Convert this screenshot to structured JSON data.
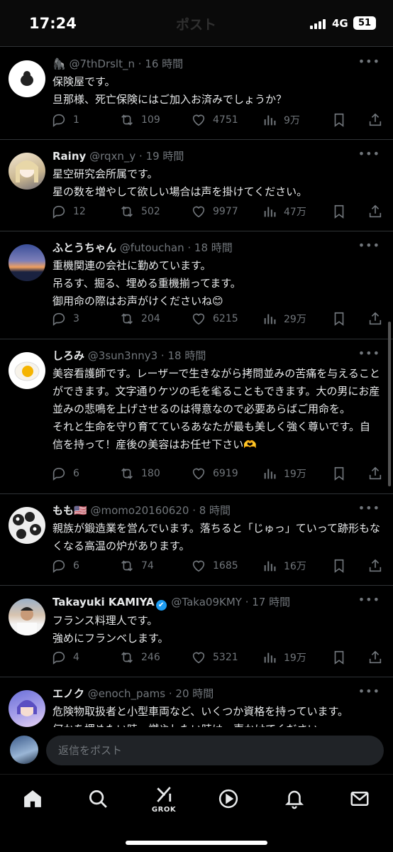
{
  "status": {
    "time": "17:24",
    "network": "4G",
    "battery": "51"
  },
  "header": {
    "title": "ポスト"
  },
  "tweets": [
    {
      "name": "",
      "badge": "🦍",
      "handle": "@7thDrslt_n",
      "time": "16 時間",
      "text": "保険屋です。\n旦那様、死亡保険にはご加入お済みでしょうか？",
      "replies": "1",
      "retweets": "109",
      "likes": "4751",
      "views": "9万"
    },
    {
      "name": "Rainy",
      "badge": "",
      "handle": "@rqxn_y",
      "time": "19 時間",
      "text": "星空研究会所属です。\n星の数を増やして欲しい場合は声を掛けてください。",
      "replies": "12",
      "retweets": "502",
      "likes": "9977",
      "views": "47万"
    },
    {
      "name": "ふとうちゃん",
      "badge": "",
      "handle": "@futouchan",
      "time": "18 時間",
      "text": "重機関連の会社に勤めています。\n吊るす、掘る、埋める重機揃ってます。\n御用命の際はお声がけくださいね😊",
      "replies": "3",
      "retweets": "204",
      "likes": "6215",
      "views": "29万"
    },
    {
      "name": "しろみ",
      "badge": "",
      "handle": "@3sun3nny3",
      "time": "18 時間",
      "text": "美容看護師です。レーザーで生きながら拷問並みの苦痛を与えることができます。文字通りケツの毛を毟ることもできます。大の男にお産並みの悲鳴を上げさせるのは得意なので必要あらばご用命を。\nそれと生命を守り育てているあなたが最も美しく強く尊いです。自信を持って！産後の美容はお任せ下さい🫶",
      "replies": "6",
      "retweets": "180",
      "likes": "6919",
      "views": "19万"
    },
    {
      "name": "もも",
      "badge": "🇺🇸",
      "handle": "@momo20160620",
      "time": "8 時間",
      "text": "親族が鍛造業を営んでいます。落ちると「じゅっ」ていって跡形もなくなる高温の炉があります。",
      "replies": "6",
      "retweets": "74",
      "likes": "1685",
      "views": "16万"
    },
    {
      "name": "Takayuki KAMIYA",
      "badge": "✔",
      "handle": "@Taka09KMY",
      "time": "17 時間",
      "text": "フランス料理人です。\n強めにフランベします。",
      "replies": "4",
      "retweets": "246",
      "likes": "5321",
      "views": "19万"
    },
    {
      "name": "エノク",
      "badge": "",
      "handle": "@enoch_pams",
      "time": "20 時間",
      "text": "危険物取扱者と小型車両など、いくつか資格を持っています。\n何かを埋めたい時、燃やしたい時は一声かけてください。",
      "replies": "",
      "retweets": "",
      "likes": "",
      "views": ""
    }
  ],
  "reply": {
    "placeholder": "返信をポスト"
  },
  "nav": {
    "grok_label": "GROK",
    "icons": [
      "home-icon",
      "search-icon",
      "grok-icon",
      "video-icon",
      "bell-icon",
      "mail-icon"
    ]
  },
  "colors": {
    "background": "#000000",
    "text": "#e7e9ea",
    "muted": "#71767b",
    "divider": "#2f3336",
    "verified": "#1d9bf0"
  }
}
